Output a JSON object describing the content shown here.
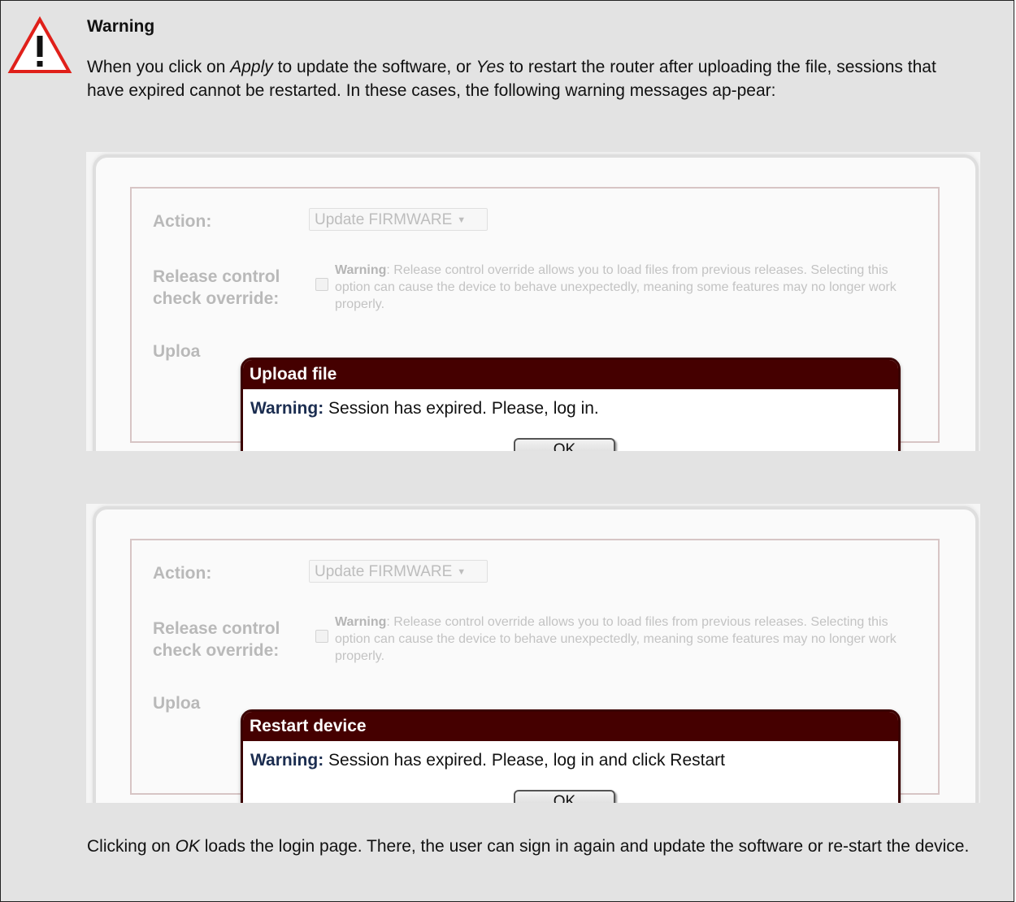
{
  "note": {
    "title": "Warning",
    "intro_segments": {
      "s1": "When you click on ",
      "apply": "Apply",
      "s2": " to update the software, or ",
      "yes": "Yes",
      "s3": "  to restart the router after uploading the file, sessions that have expired cannot be restarted. In these cases, the following warning messages ap-pear:"
    },
    "footer_segments": {
      "s1": "Clicking on ",
      "ok": "OK",
      "s2": " loads the login page. There, the user can sign in again and update the software or re-start the device."
    },
    "icon": "warning-triangle-icon",
    "icon_color": "#e0201a"
  },
  "screens": [
    {
      "action_label": "Action:",
      "action_value": "Update FIRMWARE",
      "release_label_1": "Release control",
      "release_label_2": "check override:",
      "override_warning_bold": "Warning",
      "override_warning_text": ": Release control override allows you to load files from previous releases. Selecting this option can cause the device to behave unexpectedly, meaning some features may no longer work properly.",
      "upload_label": "Uploa",
      "dialog": {
        "title": "Upload file",
        "warning_bold": "Warning:",
        "message": " Session has expired. Please, log in.",
        "ok_label": "OK"
      }
    },
    {
      "action_label": "Action:",
      "action_value": "Update FIRMWARE",
      "release_label_1": "Release control",
      "release_label_2": "check override:",
      "override_warning_bold": "Warning",
      "override_warning_text": ": Release control override allows you to load files from previous releases. Selecting this option can cause the device to behave unexpectedly, meaning some features may no longer work properly.",
      "upload_label": "Uploa",
      "dialog": {
        "title": "Restart device",
        "warning_bold": "Warning:",
        "message": " Session has expired. Please, log in and click Restart",
        "ok_label": "OK"
      }
    }
  ],
  "colors": {
    "dialog_titlebar": "#450000",
    "note_background": "#e3e3e3"
  }
}
